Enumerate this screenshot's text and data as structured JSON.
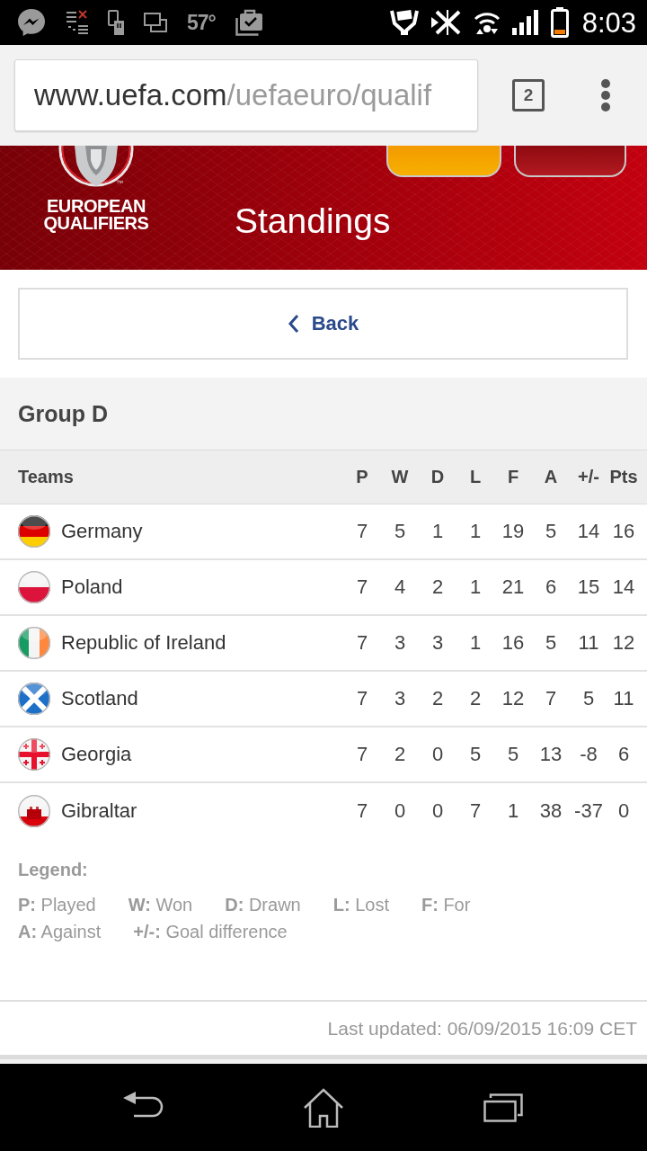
{
  "status_bar": {
    "temperature": "57°",
    "time": "8:03"
  },
  "browser": {
    "address_bar": {
      "domain": "www.uefa.com",
      "path": "/uefaeuro/qualif"
    },
    "tab_count": "2"
  },
  "header": {
    "logo_text": [
      "EUROPEAN",
      "QUALIFIERS"
    ],
    "logo_mark": "™",
    "title": "Standings"
  },
  "back_button": {
    "label": "Back"
  },
  "group": {
    "title": "Group D"
  },
  "table": {
    "columns": [
      "Teams",
      "P",
      "W",
      "D",
      "L",
      "F",
      "A",
      "+/-",
      "Pts"
    ],
    "rows": [
      {
        "kind": "de",
        "cells": [
          "Germany",
          "7",
          "5",
          "1",
          "1",
          "19",
          "5",
          "14",
          "16"
        ]
      },
      {
        "kind": "pl",
        "cells": [
          "Poland",
          "7",
          "4",
          "2",
          "1",
          "21",
          "6",
          "15",
          "14"
        ]
      },
      {
        "kind": "ie",
        "cells": [
          "Republic of Ireland",
          "7",
          "3",
          "3",
          "1",
          "16",
          "5",
          "11",
          "12"
        ]
      },
      {
        "kind": "sco",
        "cells": [
          "Scotland",
          "7",
          "3",
          "2",
          "2",
          "12",
          "7",
          "5",
          "11"
        ]
      },
      {
        "kind": "ge",
        "cells": [
          "Georgia",
          "7",
          "2",
          "0",
          "5",
          "5",
          "13",
          "-8",
          "6"
        ]
      },
      {
        "kind": "gi",
        "cells": [
          "Gibraltar",
          "7",
          "0",
          "0",
          "7",
          "1",
          "38",
          "-37",
          "0"
        ]
      }
    ]
  },
  "legend": {
    "title": "Legend:",
    "lines": [
      [
        "**P:** Played",
        "**W:** Won",
        "**D:** Drawn",
        "**L:** Lost",
        "**F:** For"
      ],
      [
        "**A:** Against",
        "**+/-:** Goal difference"
      ]
    ]
  },
  "footer": {
    "last_updated": "Last updated: 06/09/2015 16:09 CET"
  }
}
